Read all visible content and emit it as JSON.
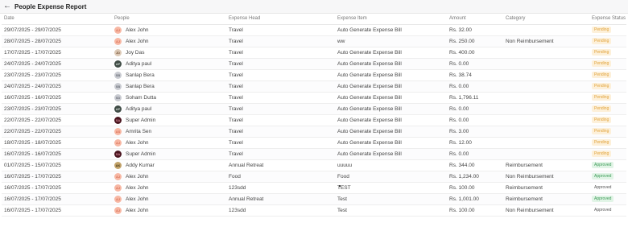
{
  "header": {
    "back_icon": "arrow-left-icon",
    "title": "People Expense Report"
  },
  "columns": [
    "Date",
    "People",
    "Expense Head",
    "Expense Item",
    "Amount",
    "Category",
    "Expense Status"
  ],
  "rows": [
    {
      "date": "29/07/2025 - 29/07/2025",
      "avatar": "alex",
      "initials": "AJ",
      "person": "Alex John",
      "head": "Travel",
      "item": "Auto Generate Expense Bill",
      "amount": "Rs. 32.00",
      "category": "",
      "status": "Pending",
      "status_type": "pending"
    },
    {
      "date": "28/07/2025 - 28/07/2025",
      "avatar": "alex",
      "initials": "AJ",
      "person": "Alex John",
      "head": "Travel",
      "item": "ww",
      "amount": "Rs. 250.00",
      "category": "Non Reimbursement",
      "status": "Pending",
      "status_type": "pending"
    },
    {
      "date": "17/07/2025 - 17/07/2025",
      "avatar": "joy",
      "initials": "JD",
      "person": "Joy Das",
      "head": "Travel",
      "item": "Auto Generate Expense Bill",
      "amount": "Rs. 400.00",
      "category": "",
      "status": "Pending",
      "status_type": "pending"
    },
    {
      "date": "24/07/2025 - 24/07/2025",
      "avatar": "aditya",
      "initials": "AP",
      "person": "Aditya paul",
      "head": "Travel",
      "item": "Auto Generate Expense Bill",
      "amount": "Rs. 0.00",
      "category": "",
      "status": "Pending",
      "status_type": "pending"
    },
    {
      "date": "23/07/2025 - 23/07/2025",
      "avatar": "sanlap",
      "initials": "SB",
      "person": "Sanlap Bera",
      "head": "Travel",
      "item": "Auto Generate Expense Bill",
      "amount": "Rs. 38.74",
      "category": "",
      "status": "Pending",
      "status_type": "pending"
    },
    {
      "date": "24/07/2025 - 24/07/2025",
      "avatar": "sanlap",
      "initials": "SB",
      "person": "Sanlap Bera",
      "head": "Travel",
      "item": "Auto Generate Expense Bill",
      "amount": "Rs. 0.00",
      "category": "",
      "status": "Pending",
      "status_type": "pending"
    },
    {
      "date": "16/07/2025 - 16/07/2025",
      "avatar": "soham",
      "initials": "SD",
      "person": "Soham Dutta",
      "head": "Travel",
      "item": "Auto Generate Expense Bill",
      "amount": "Rs. 1,796.11",
      "category": "",
      "status": "Pending",
      "status_type": "pending"
    },
    {
      "date": "23/07/2025 - 23/07/2025",
      "avatar": "aditya",
      "initials": "AP",
      "person": "Aditya paul",
      "head": "Travel",
      "item": "Auto Generate Expense Bill",
      "amount": "Rs. 0.00",
      "category": "",
      "status": "Pending",
      "status_type": "pending"
    },
    {
      "date": "22/07/2025 - 22/07/2025",
      "avatar": "super",
      "initials": "SA",
      "person": "Super Admin",
      "head": "Travel",
      "item": "Auto Generate Expense Bill",
      "amount": "Rs. 0.00",
      "category": "",
      "status": "Pending",
      "status_type": "pending"
    },
    {
      "date": "22/07/2025 - 22/07/2025",
      "avatar": "amrita",
      "initials": "AS",
      "person": "Amrita Sen",
      "head": "Travel",
      "item": "Auto Generate Expense Bill",
      "amount": "Rs. 3.00",
      "category": "",
      "status": "Pending",
      "status_type": "pending"
    },
    {
      "date": "18/07/2025 - 18/07/2025",
      "avatar": "alex",
      "initials": "AJ",
      "person": "Alex John",
      "head": "Travel",
      "item": "Auto Generate Expense Bill",
      "amount": "Rs. 12.00",
      "category": "",
      "status": "Pending",
      "status_type": "pending"
    },
    {
      "date": "16/07/2025 - 16/07/2025",
      "avatar": "super",
      "initials": "SA",
      "person": "Super Admin",
      "head": "Travel",
      "item": "Auto Generate Expense Bill",
      "amount": "Rs. 0.00",
      "category": "",
      "status": "Pending",
      "status_type": "pending"
    },
    {
      "date": "01/07/2025 - 15/07/2025",
      "avatar": "addy",
      "initials": "AK",
      "person": "Addy Kumar",
      "head": "Annual Retreat",
      "item": "uuuuu",
      "amount": "Rs. 344.00",
      "category": "Reimbursement",
      "status": "Approved",
      "status_type": "approved"
    },
    {
      "date": "16/07/2025 - 17/07/2025",
      "avatar": "alex",
      "initials": "AJ",
      "person": "Alex John",
      "head": "Food",
      "item": "Food",
      "amount": "Rs. 1,234.00",
      "category": "Non Reimbursement",
      "status": "Approved",
      "status_type": "approved"
    },
    {
      "date": "16/07/2025 - 17/07/2025",
      "avatar": "alex",
      "initials": "AJ",
      "person": "Alex John",
      "head": "123sdd",
      "item": "TEST",
      "amount": "Rs. 100.00",
      "category": "Reimbursement",
      "status": "Approved",
      "status_type": "plain"
    },
    {
      "date": "16/07/2025 - 17/07/2025",
      "avatar": "alex",
      "initials": "AJ",
      "person": "Alex John",
      "head": "Annual Retreat",
      "item": "Test",
      "amount": "Rs. 1,001.00",
      "category": "Reimbursement",
      "status": "Approved",
      "status_type": "approved"
    },
    {
      "date": "16/07/2025 - 17/07/2025",
      "avatar": "alex",
      "initials": "AJ",
      "person": "Alex John",
      "head": "123sdd",
      "item": "Test",
      "amount": "Rs. 100.00",
      "category": "Non Reimbursement",
      "status": "Approved",
      "status_type": "plain"
    }
  ],
  "colors": {
    "pending": "#e0a23a",
    "approved": "#3a9a55"
  }
}
